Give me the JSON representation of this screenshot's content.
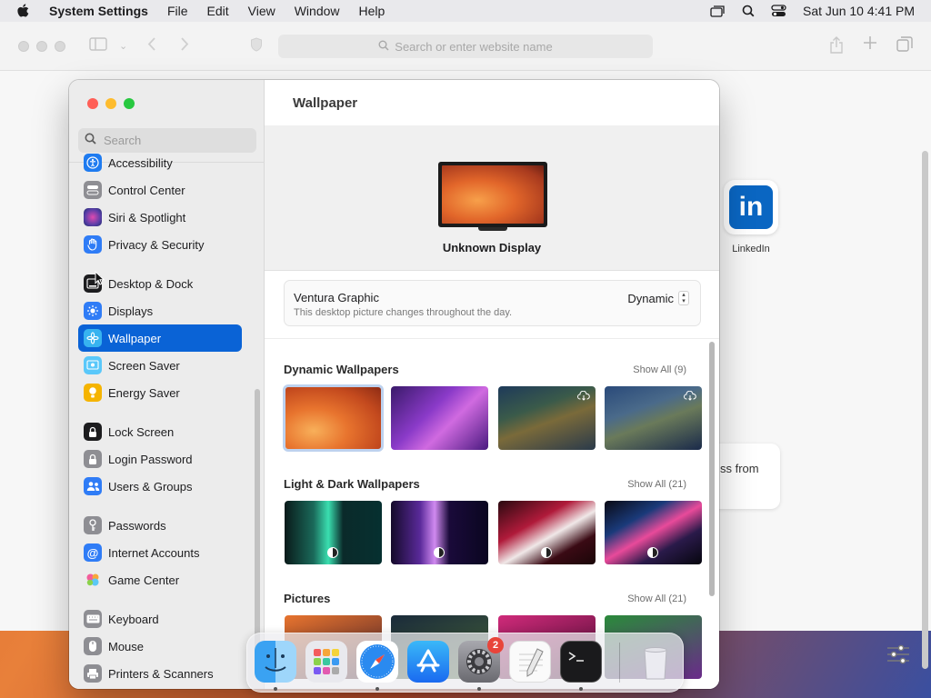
{
  "menubar": {
    "app_name": "System Settings",
    "items": [
      "File",
      "Edit",
      "View",
      "Window",
      "Help"
    ],
    "clock": "Sat Jun 10  4:41 PM"
  },
  "browser": {
    "url_placeholder": "Search or enter website name",
    "linkedin_label": "LinkedIn",
    "card_text": "ss from"
  },
  "settings": {
    "search_placeholder": "Search",
    "sidebar": [
      {
        "label": "Accessibility",
        "icon": "accessibility-icon",
        "color": "#1e7bf0"
      },
      {
        "label": "Control Center",
        "icon": "control-center-icon",
        "color": "#8e8e93"
      },
      {
        "label": "Siri & Spotlight",
        "icon": "siri-icon",
        "color": "#5a3ea8"
      },
      {
        "label": "Privacy & Security",
        "icon": "privacy-hand-icon",
        "color": "#2f7cf6"
      },
      {
        "label": "Desktop & Dock",
        "icon": "desktop-dock-icon",
        "color": "#1c1c1e"
      },
      {
        "label": "Displays",
        "icon": "displays-icon",
        "color": "#2f7cf6"
      },
      {
        "label": "Wallpaper",
        "icon": "wallpaper-icon",
        "color": "#37b3f0"
      },
      {
        "label": "Screen Saver",
        "icon": "screen-saver-icon",
        "color": "#5ac8fa"
      },
      {
        "label": "Energy Saver",
        "icon": "energy-saver-icon",
        "color": "#f5b400"
      },
      {
        "label": "Lock Screen",
        "icon": "lock-icon",
        "color": "#1c1c1e"
      },
      {
        "label": "Login Password",
        "icon": "login-password-icon",
        "color": "#8e8e93"
      },
      {
        "label": "Users & Groups",
        "icon": "users-groups-icon",
        "color": "#2f7cf6"
      },
      {
        "label": "Passwords",
        "icon": "key-icon",
        "color": "#8e8e93"
      },
      {
        "label": "Internet Accounts",
        "icon": "at-sign-icon",
        "color": "#2f7cf6"
      },
      {
        "label": "Game Center",
        "icon": "game-center-icon",
        "color": "#ffffff"
      },
      {
        "label": "Keyboard",
        "icon": "keyboard-icon",
        "color": "#8e8e93"
      },
      {
        "label": "Mouse",
        "icon": "mouse-icon",
        "color": "#8e8e93"
      },
      {
        "label": "Printers & Scanners",
        "icon": "printer-icon",
        "color": "#8e8e93"
      }
    ],
    "active_item": "Wallpaper",
    "main": {
      "title": "Wallpaper",
      "display_name": "Unknown Display",
      "wallpaper_name": "Ventura Graphic",
      "wallpaper_desc": "This desktop picture changes throughout the day.",
      "mode": "Dynamic",
      "sections": [
        {
          "title": "Dynamic Wallpapers",
          "show_all": "Show All (9)"
        },
        {
          "title": "Light & Dark Wallpapers",
          "show_all": "Show All (21)"
        },
        {
          "title": "Pictures",
          "show_all": "Show All (21)"
        }
      ]
    }
  },
  "dock": {
    "apps": [
      "Finder",
      "Launchpad",
      "Safari",
      "App Store",
      "System Settings",
      "TextEdit",
      "Terminal",
      "Trash"
    ],
    "settings_badge": "2"
  }
}
